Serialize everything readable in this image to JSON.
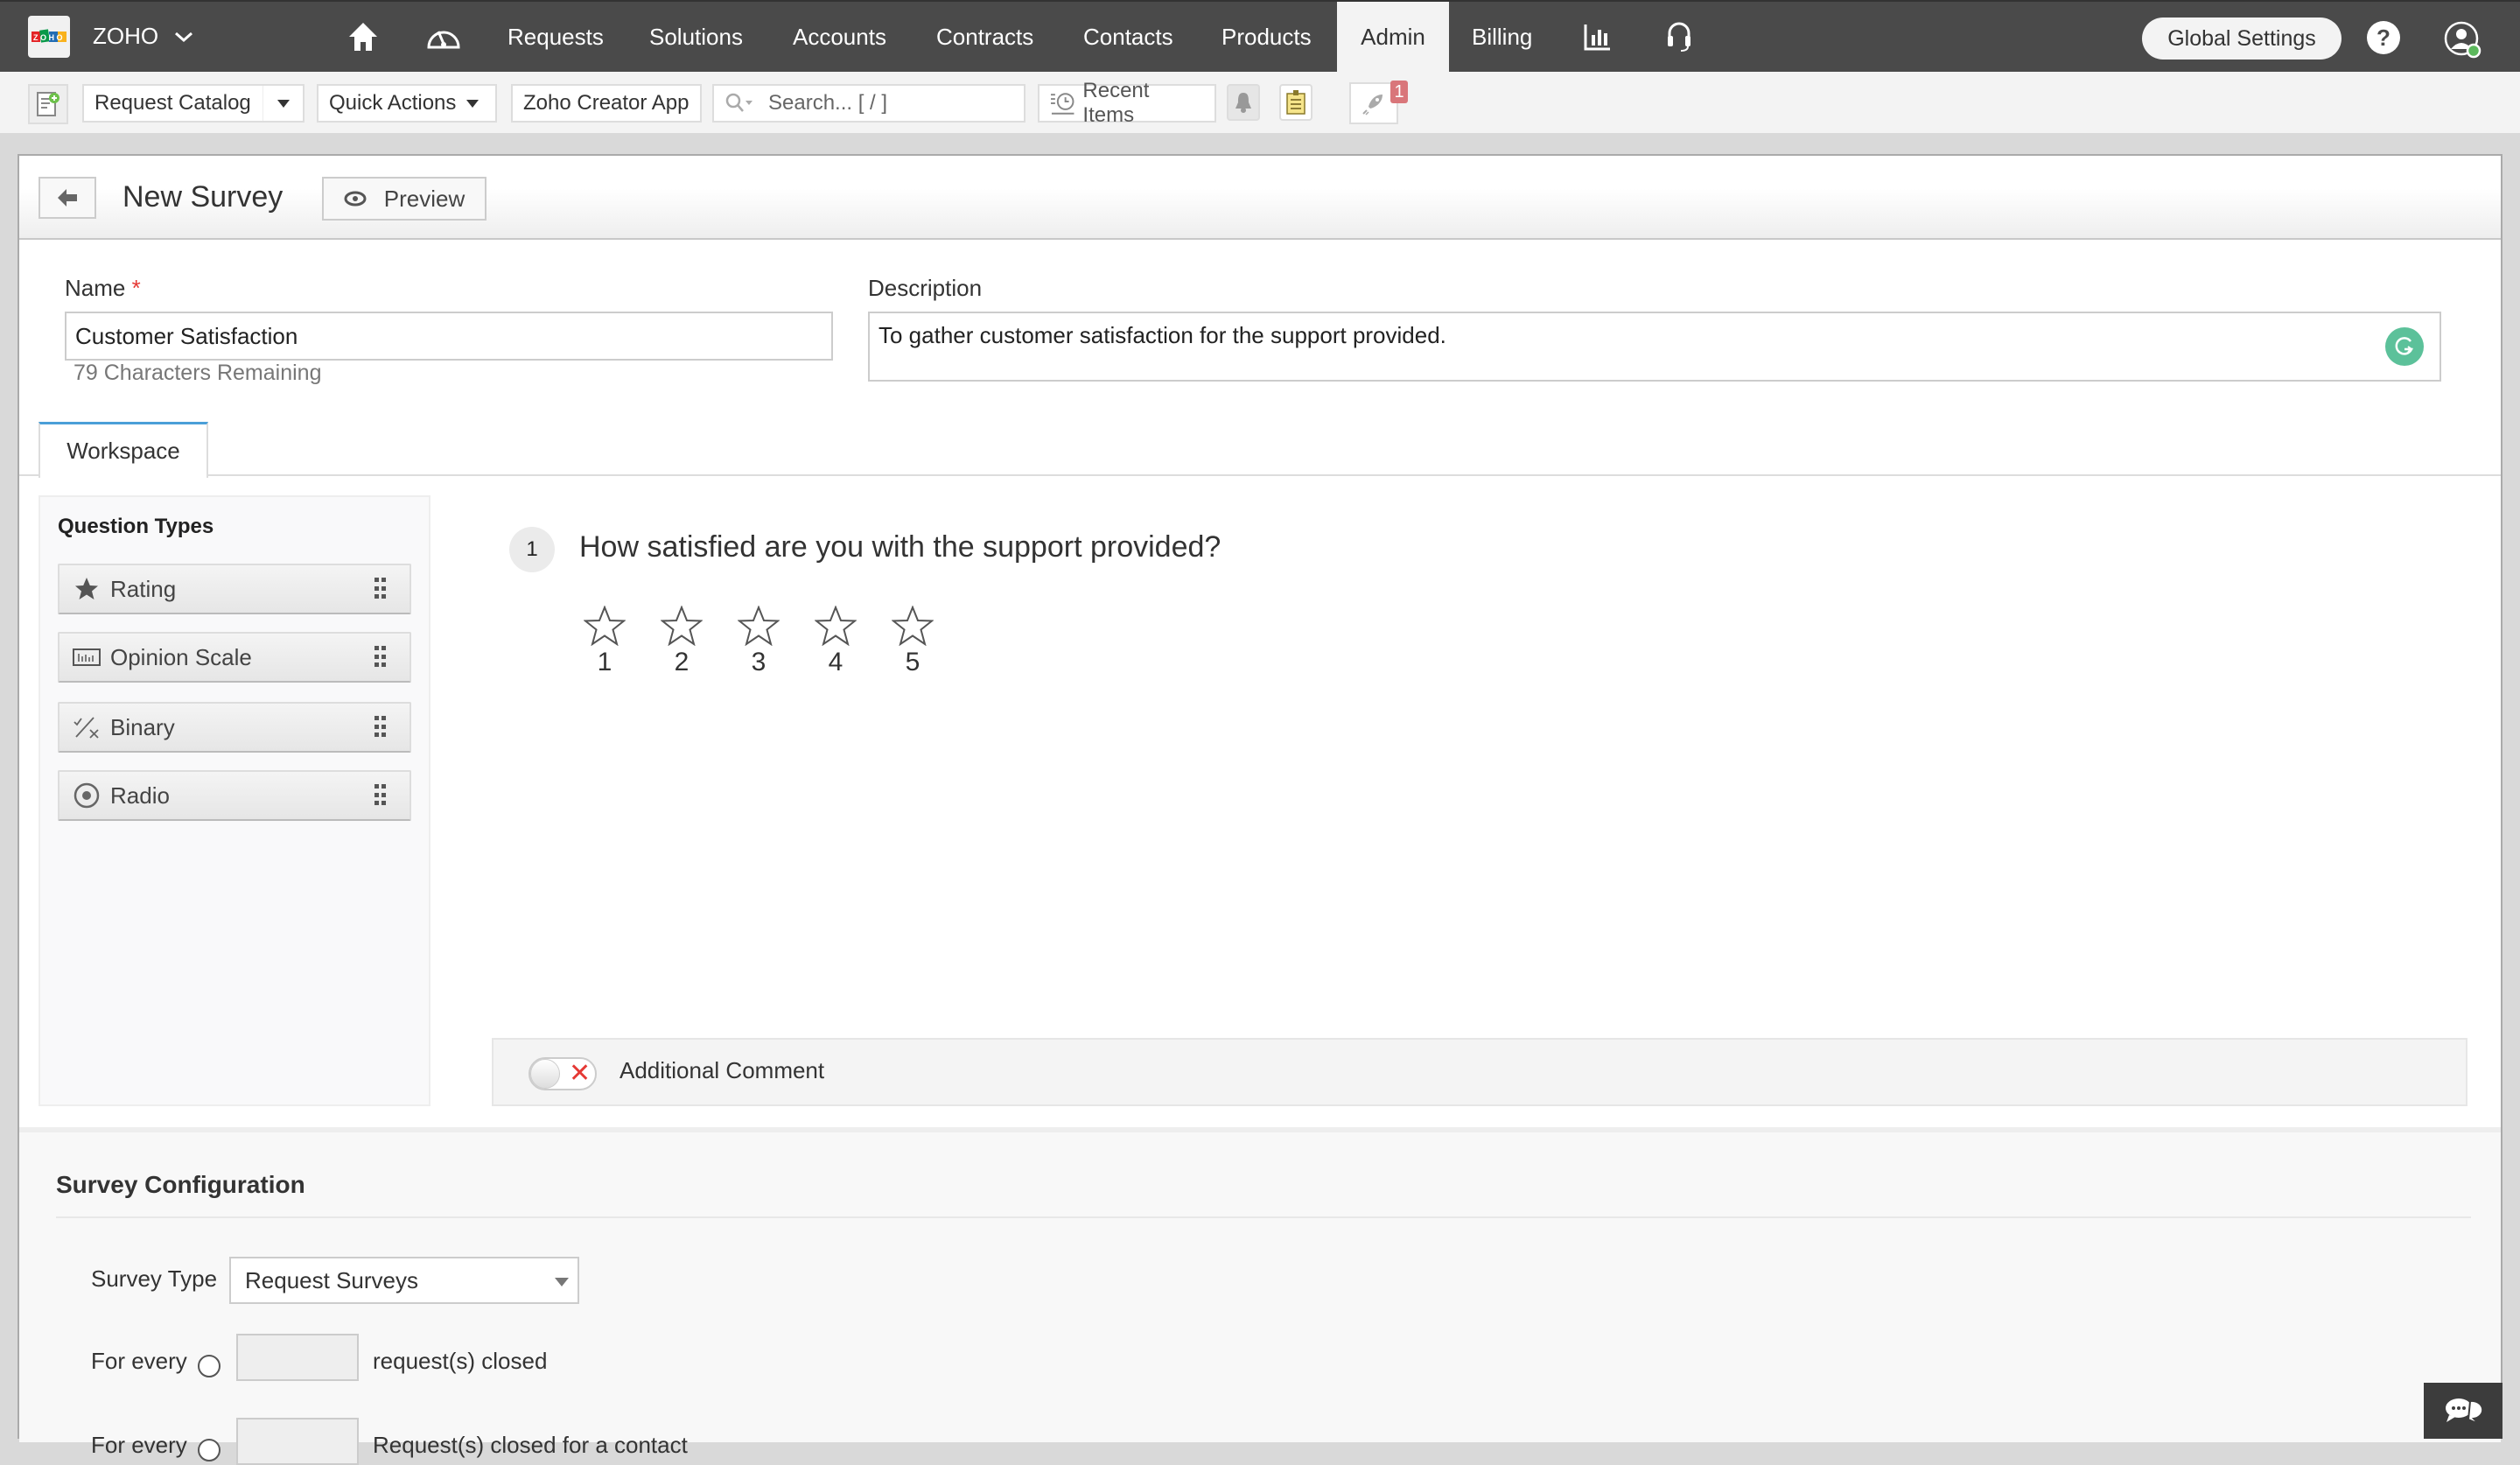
{
  "topbar": {
    "brand": "ZOHO",
    "nav": [
      {
        "label": "Requests"
      },
      {
        "label": "Solutions"
      },
      {
        "label": "Accounts"
      },
      {
        "label": "Contracts"
      },
      {
        "label": "Contacts"
      },
      {
        "label": "Products"
      },
      {
        "label": "Admin",
        "active": true
      },
      {
        "label": "Billing"
      }
    ],
    "global_settings": "Global Settings",
    "help": "?"
  },
  "toolbar": {
    "request_catalog": "Request Catalog",
    "quick_actions": "Quick Actions",
    "creator_app": "Zoho Creator App",
    "search_placeholder": "Search... [ / ]",
    "recent_items": "Recent Items",
    "notification_count": "1"
  },
  "header": {
    "title": "New Survey",
    "preview": "Preview"
  },
  "form": {
    "name_label": "Name",
    "required_mark": "*",
    "name_value": "Customer Satisfaction",
    "chars_remaining": "79 Characters Remaining",
    "description_label": "Description",
    "description_value": "To gather customer satisfaction for the support provided."
  },
  "tabs": [
    {
      "label": "Workspace",
      "active": true
    }
  ],
  "question_types": {
    "title": "Question Types",
    "items": [
      {
        "label": "Rating",
        "icon": "star-icon"
      },
      {
        "label": "Opinion Scale",
        "icon": "scale-icon"
      },
      {
        "label": "Binary",
        "icon": "binary-icon"
      },
      {
        "label": "Radio",
        "icon": "radio-icon"
      }
    ]
  },
  "question": {
    "number": "1",
    "text": "How satisfied are you with the support provided?",
    "scale": [
      "1",
      "2",
      "3",
      "4",
      "5"
    ],
    "selected_rating": 0
  },
  "additional_comment": {
    "label": "Additional Comment",
    "enabled": false
  },
  "config": {
    "title": "Survey Configuration",
    "survey_type_label": "Survey Type",
    "survey_type_value": "Request Surveys",
    "rule1_prefix": "For every",
    "rule1_value": "",
    "rule1_suffix": "request(s) closed",
    "rule2_prefix": "For every",
    "rule2_value": "",
    "rule2_suffix": "Request(s) closed for a contact"
  },
  "colors": {
    "topbar_bg": "#4a4a4a",
    "tab_accent": "#4a9fd8",
    "required": "#e53935",
    "grammarly": "#5cc19a",
    "badge": "#d9767a",
    "online": "#5cb85c"
  }
}
